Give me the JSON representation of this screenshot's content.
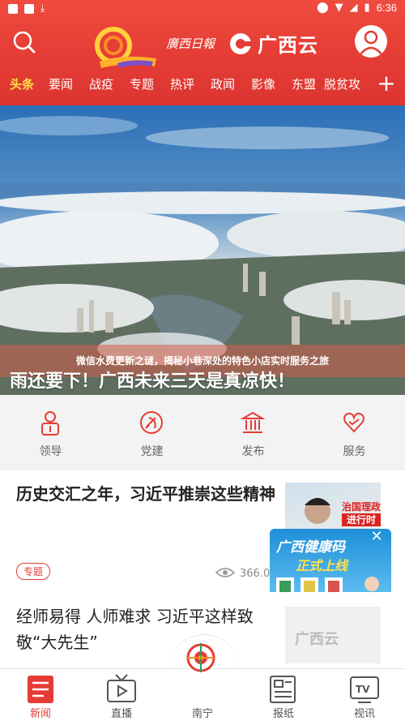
{
  "status_bar": {
    "time": "6:36"
  },
  "header": {
    "brand_signature": "廣西日報",
    "app_name": "广西云",
    "accent_color": "#e53c35"
  },
  "nav_tabs": [
    {
      "label": "头条",
      "active": true
    },
    {
      "label": "要闻"
    },
    {
      "label": "战疫"
    },
    {
      "label": "专题"
    },
    {
      "label": "热评"
    },
    {
      "label": "政闻"
    },
    {
      "label": "影像"
    },
    {
      "label": "东盟"
    },
    {
      "label": "脱贫攻"
    }
  ],
  "banner": {
    "caption": "微信水费更新之谜，揭秘小巷深处的特色小店实时服务之旅",
    "overlay_title": "雨还要下！广西未来三天是真凉快！"
  },
  "quick_links": [
    {
      "label": "领导",
      "icon": "leader-icon"
    },
    {
      "label": "党建",
      "icon": "party-icon"
    },
    {
      "label": "发布",
      "icon": "government-icon"
    },
    {
      "label": "服务",
      "icon": "heart-icon"
    }
  ],
  "articles": [
    {
      "title": "历史交汇之年，习近平推崇这些精神",
      "tag": "专题",
      "views": "366.0万",
      "thumb_text": [
        "治国理政",
        "进行时"
      ]
    },
    {
      "title": "经师易得 人师难求 习近平这样致敬“大先生”",
      "thumb_text": "广西云"
    }
  ],
  "popup": {
    "line1": "广西健康码",
    "line2": "正式上线",
    "close": "✕"
  },
  "bottom_nav": [
    {
      "label": "新闻",
      "active": true
    },
    {
      "label": "直播"
    },
    {
      "label": "南宁"
    },
    {
      "label": "报纸"
    },
    {
      "label": "视讯"
    }
  ]
}
